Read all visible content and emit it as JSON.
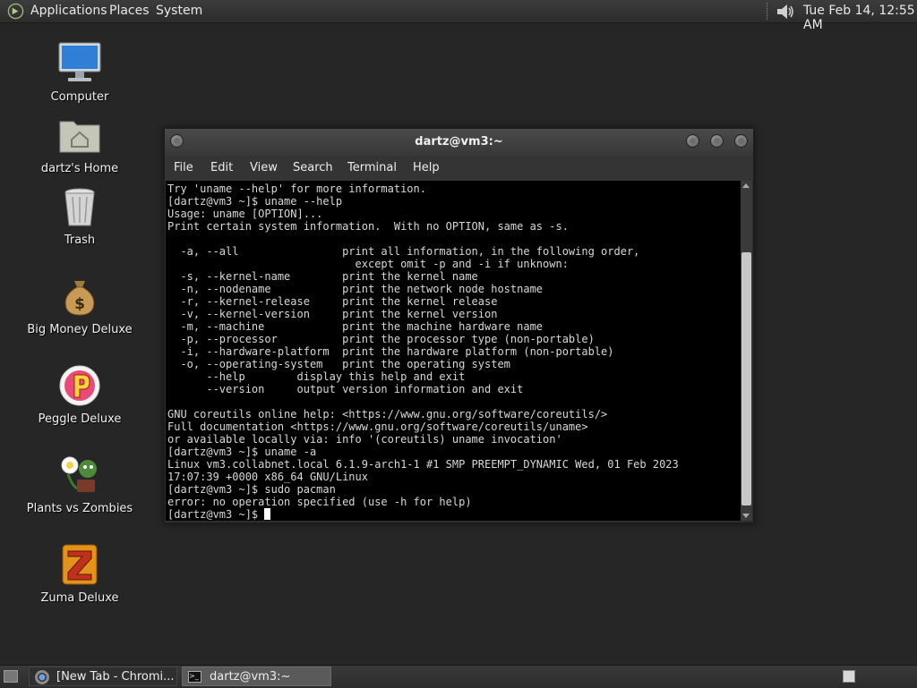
{
  "top_panel": {
    "menus": [
      "Applications",
      "Places",
      "System"
    ],
    "clock": "Tue Feb 14, 12:55 AM",
    "icons": {
      "logo": "mate-logo-icon",
      "volume": "speaker-volume-icon"
    }
  },
  "desktop": {
    "icons": [
      {
        "label": "Computer",
        "icon": "computer-monitor-icon"
      },
      {
        "label": "dartz's Home",
        "icon": "home-folder-icon"
      },
      {
        "label": "Trash",
        "icon": "trash-icon"
      },
      {
        "label": "Big Money Deluxe",
        "icon": "money-bag-icon"
      },
      {
        "label": "Peggle Deluxe",
        "icon": "peggle-icon"
      },
      {
        "label": "Plants vs Zombies",
        "icon": "plants-vs-zombies-icon"
      },
      {
        "label": "Zuma Deluxe",
        "icon": "zuma-icon"
      }
    ]
  },
  "terminal": {
    "title": "dartz@vm3:~",
    "menu": [
      "File",
      "Edit",
      "View",
      "Search",
      "Terminal",
      "Help"
    ],
    "lines": [
      "Try 'uname --help' for more information.",
      "[dartz@vm3 ~]$ uname --help",
      "Usage: uname [OPTION]...",
      "Print certain system information.  With no OPTION, same as -s.",
      "",
      "  -a, --all                print all information, in the following order,",
      "                             except omit -p and -i if unknown:",
      "  -s, --kernel-name        print the kernel name",
      "  -n, --nodename           print the network node hostname",
      "  -r, --kernel-release     print the kernel release",
      "  -v, --kernel-version     print the kernel version",
      "  -m, --machine            print the machine hardware name",
      "  -p, --processor          print the processor type (non-portable)",
      "  -i, --hardware-platform  print the hardware platform (non-portable)",
      "  -o, --operating-system   print the operating system",
      "      --help        display this help and exit",
      "      --version     output version information and exit",
      "",
      "GNU coreutils online help: <https://www.gnu.org/software/coreutils/>",
      "Full documentation <https://www.gnu.org/software/coreutils/uname>",
      "or available locally via: info '(coreutils) uname invocation'",
      "[dartz@vm3 ~]$ uname -a",
      "Linux vm3.collabnet.local 6.1.9-arch1-1 #1 SMP PREEMPT_DYNAMIC Wed, 01 Feb 2023",
      "17:07:39 +0000 x86_64 GNU/Linux",
      "[dartz@vm3 ~]$ sudo pacman",
      "error: no operation specified (use -h for help)"
    ],
    "prompt": "[dartz@vm3 ~]$ "
  },
  "taskbar": {
    "tasks": [
      {
        "label": "[New Tab - Chromi...",
        "icon": "chromium-icon"
      },
      {
        "label": "dartz@vm3:~",
        "icon": "terminal-icon"
      }
    ]
  }
}
